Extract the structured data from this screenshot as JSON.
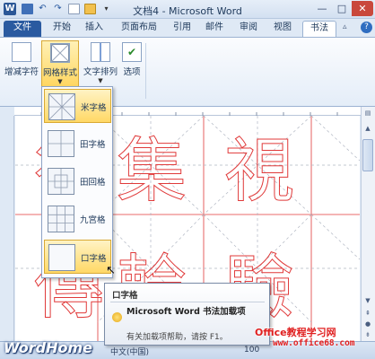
{
  "window": {
    "app_icon_letter": "W",
    "title": "文档4 - Microsoft Word",
    "minimize_glyph": "—",
    "maximize_glyph": "□",
    "close_glyph": "✕"
  },
  "tabs": {
    "file": "文件",
    "items": [
      "开始",
      "插入",
      "页面布局",
      "引用",
      "邮件",
      "审阅",
      "视图"
    ],
    "active": "书法"
  },
  "ribbon": {
    "buttons": [
      {
        "label": "增减字符",
        "has_dropdown": false
      },
      {
        "label": "网格样式",
        "has_dropdown": true
      },
      {
        "label": "文字排列",
        "has_dropdown": true
      },
      {
        "label": "选项",
        "has_dropdown": false
      }
    ]
  },
  "gallery": {
    "items": [
      {
        "label": "米字格",
        "style": "mi",
        "selected": true
      },
      {
        "label": "田字格",
        "style": "tian",
        "selected": false
      },
      {
        "label": "田回格",
        "style": "tianhui",
        "selected": false
      },
      {
        "label": "九宫格",
        "style": "jiugong",
        "selected": false
      },
      {
        "label": "口字格",
        "style": "kou",
        "selected": true
      }
    ]
  },
  "document": {
    "characters": [
      "欲",
      "集",
      "視",
      "傳",
      "輪",
      "驗"
    ],
    "char_color": "#e03a3a"
  },
  "tooltip": {
    "title": "口字格",
    "addin_name": "Microsoft Word 书法加载项",
    "help_text": "有关加载项帮助，请按 F1。"
  },
  "statusbar": {
    "language": "中文(中国)",
    "zoom": "100"
  },
  "watermarks": {
    "wordhome": "WordHome",
    "office_site_name": "Office教程学习网",
    "office_site_url": "www.office68.com"
  },
  "colors": {
    "accent": "#2a5aa0",
    "selection": "#ffd866",
    "grid_line": "#e03a3a"
  }
}
